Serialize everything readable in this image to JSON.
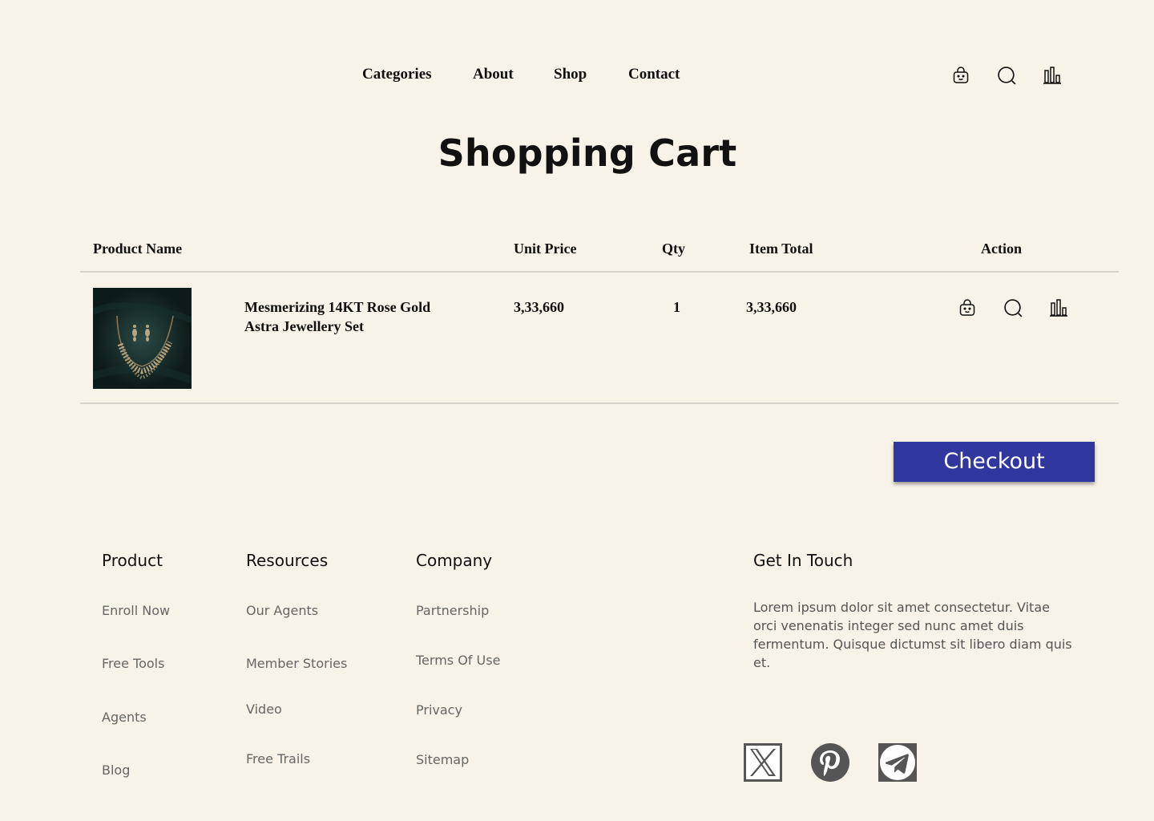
{
  "nav": {
    "links": [
      "Categories",
      "About",
      "Shop",
      "Contact"
    ],
    "icons": [
      "bag-icon",
      "search-icon",
      "chart-icon"
    ]
  },
  "page": {
    "title": "Shopping Cart"
  },
  "cart": {
    "headers": {
      "product": "Product Name",
      "unit_price": "Unit Price",
      "qty": "Qty",
      "total": "Item Total",
      "action": "Action"
    },
    "items": [
      {
        "name": "Mesmerizing 14KT Rose Gold Astra Jewellery Set",
        "unit_price": "3,33,660",
        "qty": "1",
        "total": "3,33,660",
        "actions": [
          "bag-icon",
          "search-icon",
          "chart-icon"
        ]
      }
    ],
    "checkout_label": "Checkout"
  },
  "footer": {
    "columns": [
      {
        "title": "Product",
        "links": [
          "Enroll Now",
          "Free Tools",
          "Agents",
          "Blog"
        ]
      },
      {
        "title": "Resources",
        "links": [
          "Our Agents",
          "Member Stories",
          "Video",
          "Free Trails"
        ]
      },
      {
        "title": "Company",
        "links": [
          "Partnership",
          "Terms Of Use",
          "Privacy",
          "Sitemap"
        ]
      }
    ],
    "contact": {
      "title": "Get In Touch",
      "text": "Lorem ipsum dolor sit amet consectetur. Vitae orci venenatis integer sed nunc amet duis fermentum. Quisque dictumst sit libero diam quis et."
    },
    "social": [
      "x-icon",
      "pinterest-icon",
      "telegram-icon"
    ]
  },
  "colors": {
    "background": "#f7f3e9",
    "accent": "#3038a0",
    "muted_text": "#666666"
  }
}
